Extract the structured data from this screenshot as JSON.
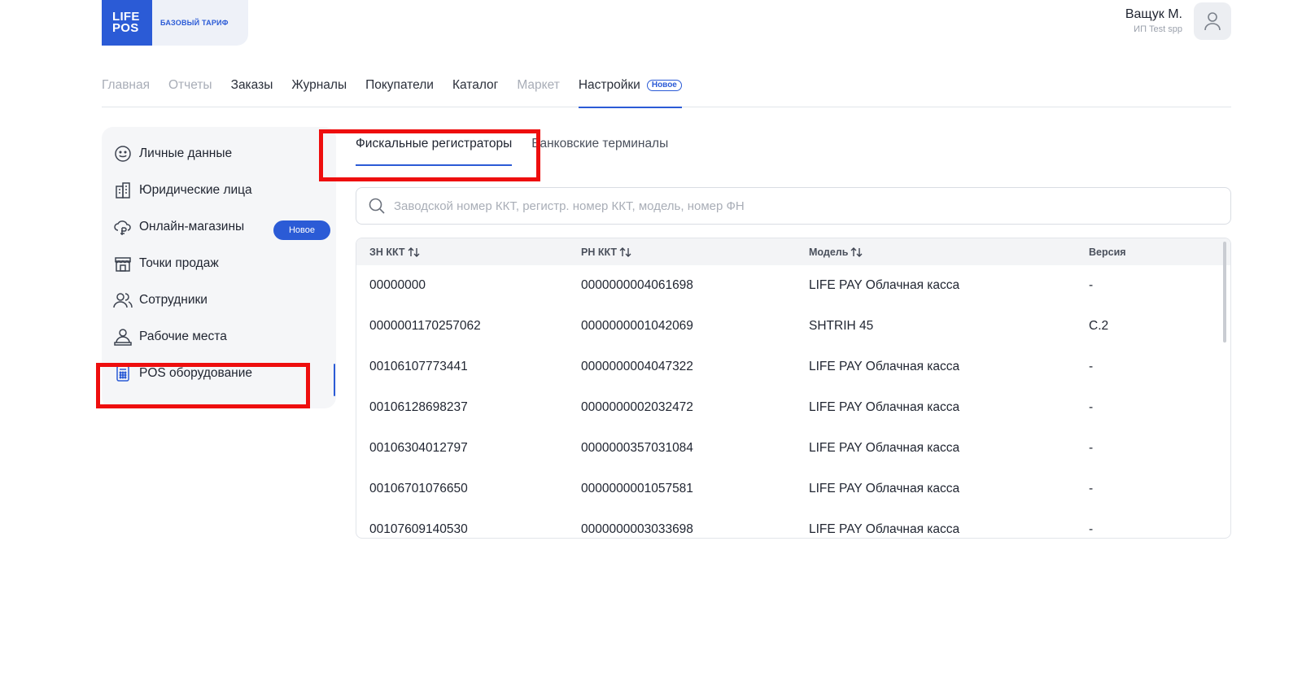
{
  "header": {
    "logo_line1": "LIFE",
    "logo_line2": "POS",
    "plan": "БАЗОВЫЙ ТАРИФ",
    "user_name": "Ващук М.",
    "user_org": "ИП Test spp",
    "avatar_icon": "user-icon"
  },
  "topnav": {
    "items": [
      "Главная",
      "Отчеты",
      "Заказы",
      "Журналы",
      "Покупатели",
      "Каталог",
      "Маркет",
      "Настройки"
    ],
    "active": "Настройки",
    "new_badge": "Новое"
  },
  "sidebar": {
    "items": [
      {
        "label": "Личные данные",
        "icon": "smile-icon"
      },
      {
        "label": "Юридические лица",
        "icon": "building-icon"
      },
      {
        "label": "Онлайн-магазины",
        "icon": "cloud-ruble-icon"
      },
      {
        "label": "Точки продаж",
        "icon": "store-icon"
      },
      {
        "label": "Сотрудники",
        "icon": "users-icon"
      },
      {
        "label": "Рабочие места",
        "icon": "workstation-user-icon"
      },
      {
        "label": "POS оборудование",
        "icon": "calculator-icon"
      }
    ],
    "new_badge": "Новое",
    "active": "POS оборудование"
  },
  "tabs": {
    "fiscal": "Фискальные регистраторы",
    "bank": "Банковские терминалы"
  },
  "search": {
    "placeholder": "Заводской номер ККТ, регистр. номер ККТ, модель, номер ФН",
    "value": ""
  },
  "table": {
    "columns": [
      "ЗН ККТ",
      "РН ККТ",
      "Модель",
      "Версия"
    ],
    "rows": [
      [
        "00000000",
        "0000000004061698",
        "LIFE PAY Облачная касса",
        "-"
      ],
      [
        "0000001170257062",
        "0000000001042069",
        "SHTRIH 45",
        "C.2"
      ],
      [
        "00106107773441",
        "0000000004047322",
        "LIFE PAY Облачная касса",
        "-"
      ],
      [
        "00106128698237",
        "0000000002032472",
        "LIFE PAY Облачная касса",
        "-"
      ],
      [
        "00106304012797",
        "0000000357031084",
        "LIFE PAY Облачная касса",
        "-"
      ],
      [
        "00106701076650",
        "0000000001057581",
        "LIFE PAY Облачная касса",
        "-"
      ],
      [
        "00107609140530",
        "0000000003033698",
        "LIFE PAY Облачная касса",
        "-"
      ]
    ]
  },
  "colors": {
    "accent": "#2b5bd6",
    "highlight": "#ee0e0e",
    "sidebar_bg": "#f5f6f8"
  }
}
